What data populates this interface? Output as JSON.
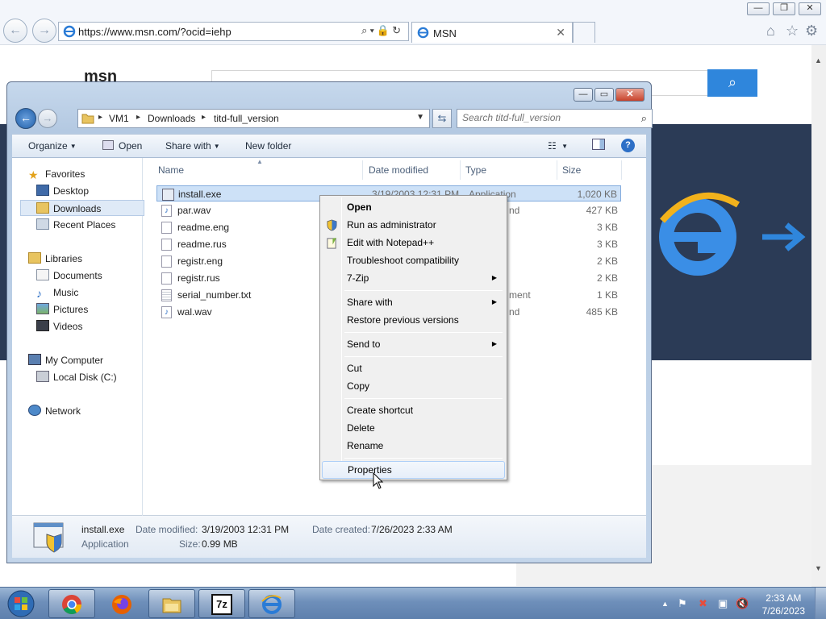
{
  "browser": {
    "url": "https://www.msn.com/?ocid=iehp",
    "tab_title": "MSN",
    "window_buttons": {
      "minimize": "—",
      "restore": "❐",
      "close": "✕"
    },
    "right_icons": [
      "home-icon",
      "star-icon",
      "gear-icon"
    ]
  },
  "msn": {
    "logo_text": "msn",
    "search_placeholder": ""
  },
  "explorer": {
    "breadcrumb": [
      "VM1",
      "Downloads",
      "titd-full_version"
    ],
    "search_placeholder": "Search titd-full_version",
    "toolbar": {
      "organize": "Organize",
      "open": "Open",
      "share_with": "Share with",
      "new_folder": "New folder"
    },
    "nav_pane": {
      "favorites": "Favorites",
      "desktop": "Desktop",
      "downloads": "Downloads",
      "recent_places": "Recent Places",
      "libraries": "Libraries",
      "documents": "Documents",
      "music": "Music",
      "pictures": "Pictures",
      "videos": "Videos",
      "my_computer": "My Computer",
      "local_disk": "Local Disk (C:)",
      "network": "Network"
    },
    "columns": {
      "name": "Name",
      "date": "Date modified",
      "type": "Type",
      "size": "Size"
    },
    "files": [
      {
        "name": "install.exe",
        "date": "3/19/2003 12:31 PM",
        "type": "Application",
        "size": "1,020 KB",
        "icon": "exe-icon"
      },
      {
        "name": "par.wav",
        "date": "",
        "type": "nd",
        "size": "427 KB",
        "icon": "audio-icon"
      },
      {
        "name": "readme.eng",
        "date": "",
        "type": "",
        "size": "3 KB",
        "icon": "file-icon"
      },
      {
        "name": "readme.rus",
        "date": "",
        "type": "",
        "size": "3 KB",
        "icon": "file-icon"
      },
      {
        "name": "registr.eng",
        "date": "",
        "type": "",
        "size": "2 KB",
        "icon": "file-icon"
      },
      {
        "name": "registr.rus",
        "date": "",
        "type": "",
        "size": "2 KB",
        "icon": "file-icon"
      },
      {
        "name": "serial_number.txt",
        "date": "",
        "type": "ment",
        "size": "1 KB",
        "icon": "text-file-icon"
      },
      {
        "name": "wal.wav",
        "date": "",
        "type": "nd",
        "size": "485 KB",
        "icon": "audio-icon"
      }
    ],
    "details": {
      "filename": "install.exe",
      "kind": "Application",
      "modified_label": "Date modified:",
      "modified_value": "3/19/2003 12:31 PM",
      "created_label": "Date created:",
      "created_value": "7/26/2023 2:33 AM",
      "size_label": "Size:",
      "size_value": "0.99 MB"
    }
  },
  "context_menu": {
    "open": "Open",
    "run_as_admin": "Run as administrator",
    "edit_notepad": "Edit with Notepad++",
    "troubleshoot": "Troubleshoot compatibility",
    "seven_zip": "7-Zip",
    "share_with": "Share with",
    "restore_versions": "Restore previous versions",
    "send_to": "Send to",
    "cut": "Cut",
    "copy": "Copy",
    "create_shortcut": "Create shortcut",
    "delete": "Delete",
    "rename": "Rename",
    "properties": "Properties"
  },
  "taskbar": {
    "apps": [
      "chrome-icon",
      "firefox-icon",
      "file-explorer-icon",
      "7zip-icon",
      "internet-explorer-icon"
    ],
    "seven_zip_label": "7z",
    "time": "2:33 AM",
    "date": "7/26/2023"
  },
  "colors": {
    "explorer_frame": "#b4c9e2",
    "selection": "#cde1f7",
    "msn_blue": "#2f86dc",
    "banner_navy": "#2b3b56",
    "taskbar": "#6e8fba"
  }
}
